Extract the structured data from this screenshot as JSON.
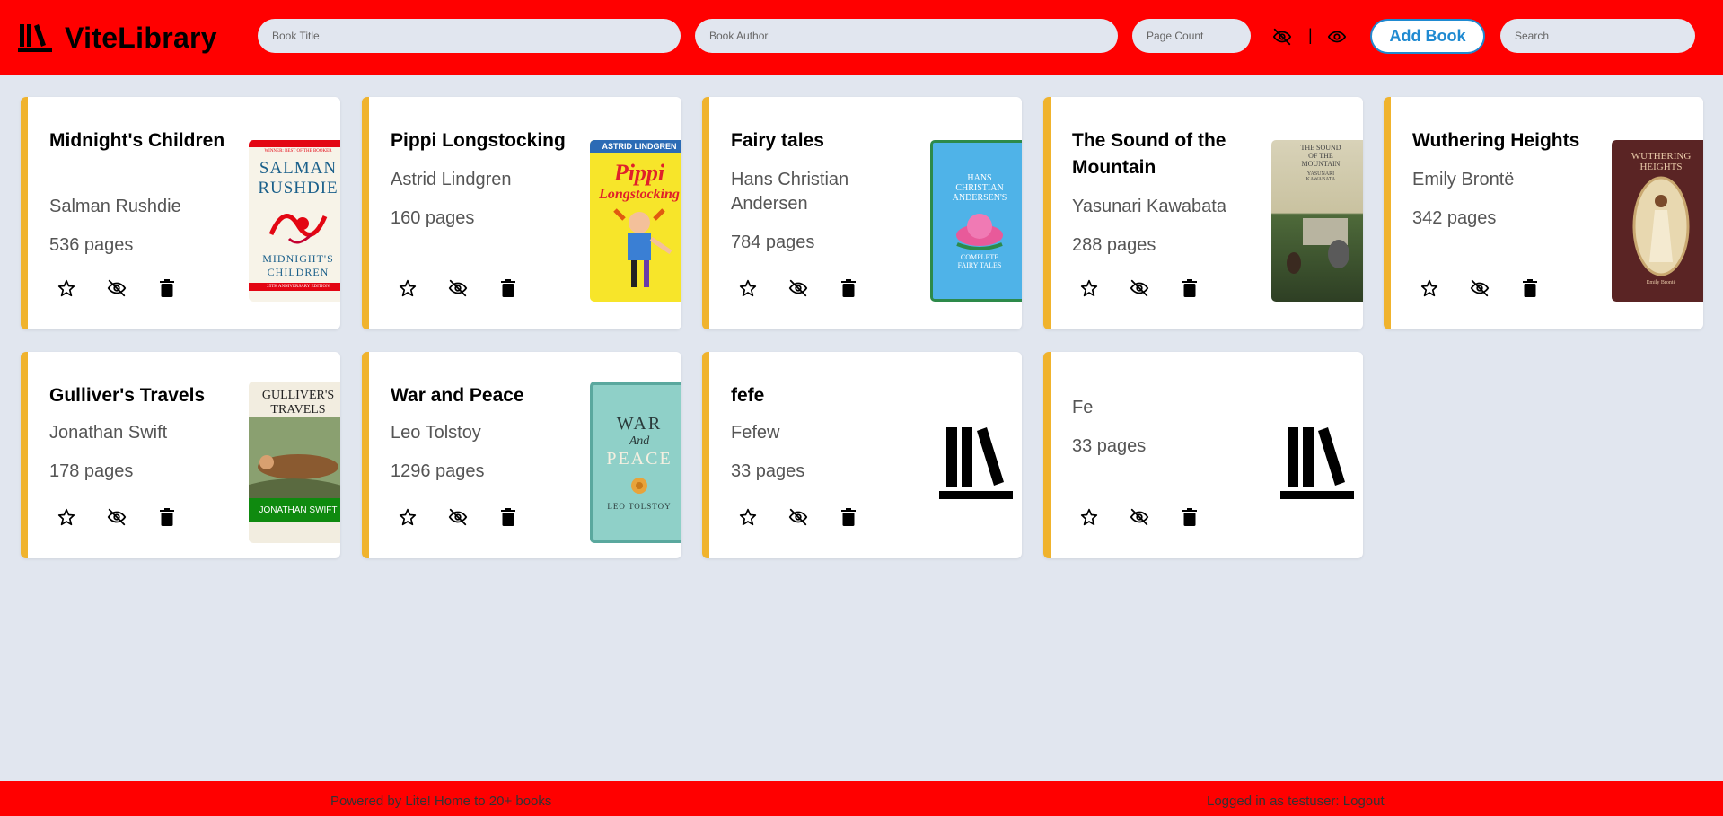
{
  "app": {
    "brand": "ViteLibrary",
    "logo_icon": "bookshelf-icon"
  },
  "header": {
    "title_placeholder": "Book Title",
    "author_placeholder": "Book Author",
    "pages_placeholder": "Page Count",
    "hide_icon": "eye-slash-icon",
    "separator": "|",
    "show_icon": "eye-icon",
    "add_label": "Add Book",
    "search_placeholder": "Search"
  },
  "accent_colors": {
    "header": "#ff0000",
    "card_stripe": "#f0b32d",
    "button": "#1f8ad1",
    "background": "#e1e6ef"
  },
  "books": [
    {
      "title": "Midnight's Children",
      "author": "Salman Rushdie",
      "pages": "536 pages",
      "cover": "Midnight's Children cover"
    },
    {
      "title": "Pippi Longstocking",
      "author": "Astrid Lindgren",
      "pages": "160 pages",
      "cover": "Pippi Longstocking cover"
    },
    {
      "title": "Fairy tales",
      "author": "Hans Christian Andersen",
      "pages": "784 pages",
      "cover": "Fairy tales cover"
    },
    {
      "title": "The Sound of the Mountain",
      "author": "Yasunari Kawabata",
      "pages": "288 pages",
      "cover": "The Sound of the Mountain cover"
    },
    {
      "title": "Wuthering Heights",
      "author": "Emily Brontë",
      "pages": "342 pages",
      "cover": "Wuthering Heights cover"
    },
    {
      "title": "Gulliver's Travels",
      "author": "Jonathan Swift",
      "pages": "178 pages",
      "cover": "Gulliver's Travels cover"
    },
    {
      "title": "War and Peace",
      "author": "Leo Tolstoy",
      "pages": "1296 pages",
      "cover": "War and Peace cover"
    },
    {
      "title": "fefe",
      "author": "Fefew",
      "pages": "33 pages",
      "cover": "bookshelf-icon"
    },
    {
      "title": "",
      "author": "Fe",
      "pages": "33 pages",
      "cover": "bookshelf-icon"
    }
  ],
  "covers": {
    "midnights": {
      "banner": "WINNER: BEST OF THE BOOKER",
      "line1": "SALMAN",
      "line2": "RUSHDIE",
      "line3": "MIDNIGHT'S",
      "line4": "CHILDREN",
      "line5": "25TH ANNIVERSARY EDITION"
    },
    "pippi": {
      "banner": "ASTRID LINDGREN",
      "line1": "Pippi",
      "line2": "Longstocking"
    },
    "fairy": {
      "line1": "HANS",
      "line2": "CHRISTIAN",
      "line3": "ANDERSEN'S",
      "line4": "COMPLETE",
      "line5": "FAIRY TALES"
    },
    "sound": {
      "line1": "THE SOUND",
      "line2": "OF THE",
      "line3": "MOUNTAIN",
      "line4": "YASUNARI",
      "line5": "KAWABATA"
    },
    "wuthering": {
      "line1": "WUTHERING",
      "line2": "HEIGHTS",
      "line3": "Emily Brontë"
    },
    "gulliver": {
      "line1": "GULLIVER'S",
      "line2": "TRAVELS",
      "line3": "JONATHAN SWIFT"
    },
    "war": {
      "line1": "WAR",
      "line2": "And",
      "line3": "PEACE",
      "line4": "LEO TOLSTOY"
    }
  },
  "card_actions": {
    "favorite_icon": "star-icon",
    "hide_icon": "eye-slash-icon",
    "delete_icon": "trash-icon"
  },
  "footer": {
    "left": "Powered by Lite! Home to 20+ books",
    "right_prefix": "Logged in as testuser: ",
    "logout": "Logout"
  }
}
